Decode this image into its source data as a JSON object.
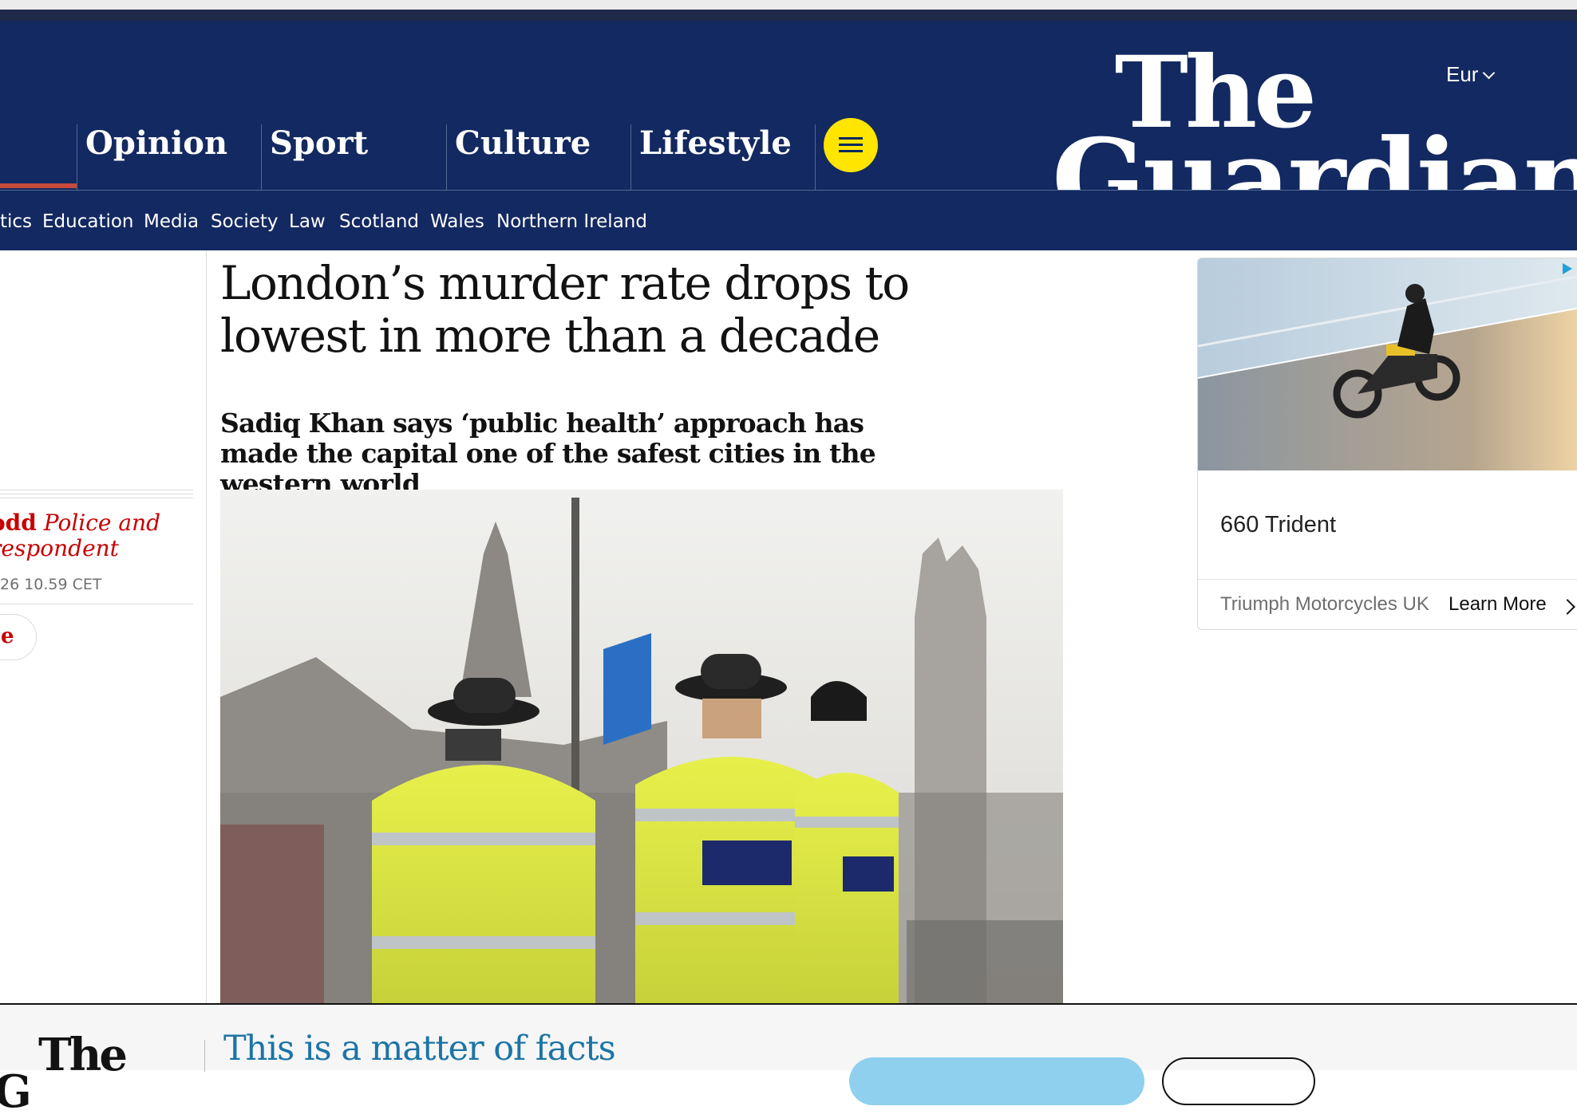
{
  "header": {
    "edition": "Eur",
    "logo_the": "The",
    "logo_guardian": "Guardian",
    "pillars": [
      "Opinion",
      "Sport",
      "Culture",
      "Lifestyle"
    ],
    "subnav": [
      "tics",
      "Education",
      "Media",
      "Society",
      "Law",
      "Scotland",
      "Wales",
      "Northern Ireland"
    ]
  },
  "article": {
    "headline": "London’s murder rate drops to lowest in more than a decade",
    "standfirst": "Sadiq Khan says ‘public health’ approach has made the capital one of the safest cities in the western world",
    "byline_name": "odd",
    "byline_role": "Police and respondent",
    "dateline": "26 10.59 CET",
    "share_label": "e"
  },
  "ad": {
    "title": "660 Trident",
    "advertiser": "Triumph Motorcycles UK",
    "cta": "Learn More"
  },
  "footer_banner": {
    "logo": "The",
    "logo_second": "G",
    "headline": "This is a matter of facts"
  },
  "colors": {
    "brand_navy": "#132961",
    "menu_yellow": "#ffe500",
    "news_red": "#c70000",
    "facts_blue": "#1c74a6"
  },
  "icons": [
    "menu-icon",
    "chevron-down-icon",
    "chevron-right-icon",
    "adchoices-icon"
  ]
}
